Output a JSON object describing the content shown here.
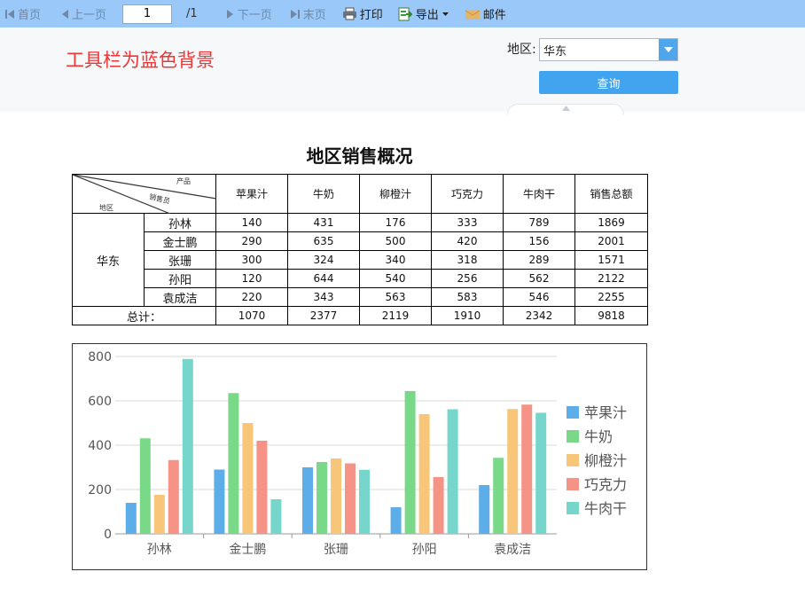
{
  "toolbar": {
    "first_label": "首页",
    "prev_label": "上一页",
    "page_current": "1",
    "page_total": "/1",
    "next_label": "下一页",
    "last_label": "末页",
    "print_label": "打印",
    "export_label": "导出",
    "email_label": "邮件"
  },
  "params": {
    "headline": "工具栏为蓝色背景",
    "region_label": "地区:",
    "region_value": "华东",
    "query_label": "查询"
  },
  "report": {
    "title": "地区销售概况",
    "corner": {
      "product": "产品",
      "salesperson": "销售员",
      "region": "地区"
    },
    "columns": [
      "苹果汁",
      "牛奶",
      "柳橙汁",
      "巧克力",
      "牛肉干",
      "销售总额"
    ],
    "region": "华东",
    "rows": [
      {
        "name": "孙林",
        "values": [
          "140",
          "431",
          "176",
          "333",
          "789",
          "1869"
        ]
      },
      {
        "name": "金士鹏",
        "values": [
          "290",
          "635",
          "500",
          "420",
          "156",
          "2001"
        ]
      },
      {
        "name": "张珊",
        "values": [
          "300",
          "324",
          "340",
          "318",
          "289",
          "1571"
        ]
      },
      {
        "name": "孙阳",
        "values": [
          "120",
          "644",
          "540",
          "256",
          "562",
          "2122"
        ]
      },
      {
        "name": "袁成洁",
        "values": [
          "220",
          "343",
          "563",
          "583",
          "546",
          "2255"
        ]
      }
    ],
    "total_label": "总计：",
    "totals": [
      "1070",
      "2377",
      "2119",
      "1910",
      "2342",
      "9818"
    ]
  },
  "chart_data": {
    "type": "bar",
    "categories": [
      "孙林",
      "金士鹏",
      "张珊",
      "孙阳",
      "袁成洁"
    ],
    "series": [
      {
        "name": "苹果汁",
        "color": "#5dade8",
        "values": [
          140,
          290,
          300,
          120,
          220
        ]
      },
      {
        "name": "牛奶",
        "color": "#7ad989",
        "values": [
          431,
          635,
          324,
          644,
          343
        ]
      },
      {
        "name": "柳橙汁",
        "color": "#f7c679",
        "values": [
          176,
          500,
          340,
          540,
          563
        ]
      },
      {
        "name": "巧克力",
        "color": "#f59486",
        "values": [
          333,
          420,
          318,
          256,
          583
        ]
      },
      {
        "name": "牛肉干",
        "color": "#76d6cc",
        "values": [
          789,
          156,
          289,
          562,
          546
        ]
      }
    ],
    "ylim": [
      0,
      800
    ],
    "yticks": [
      "0",
      "200",
      "400",
      "600",
      "800"
    ],
    "grid": true,
    "legend": "right"
  }
}
